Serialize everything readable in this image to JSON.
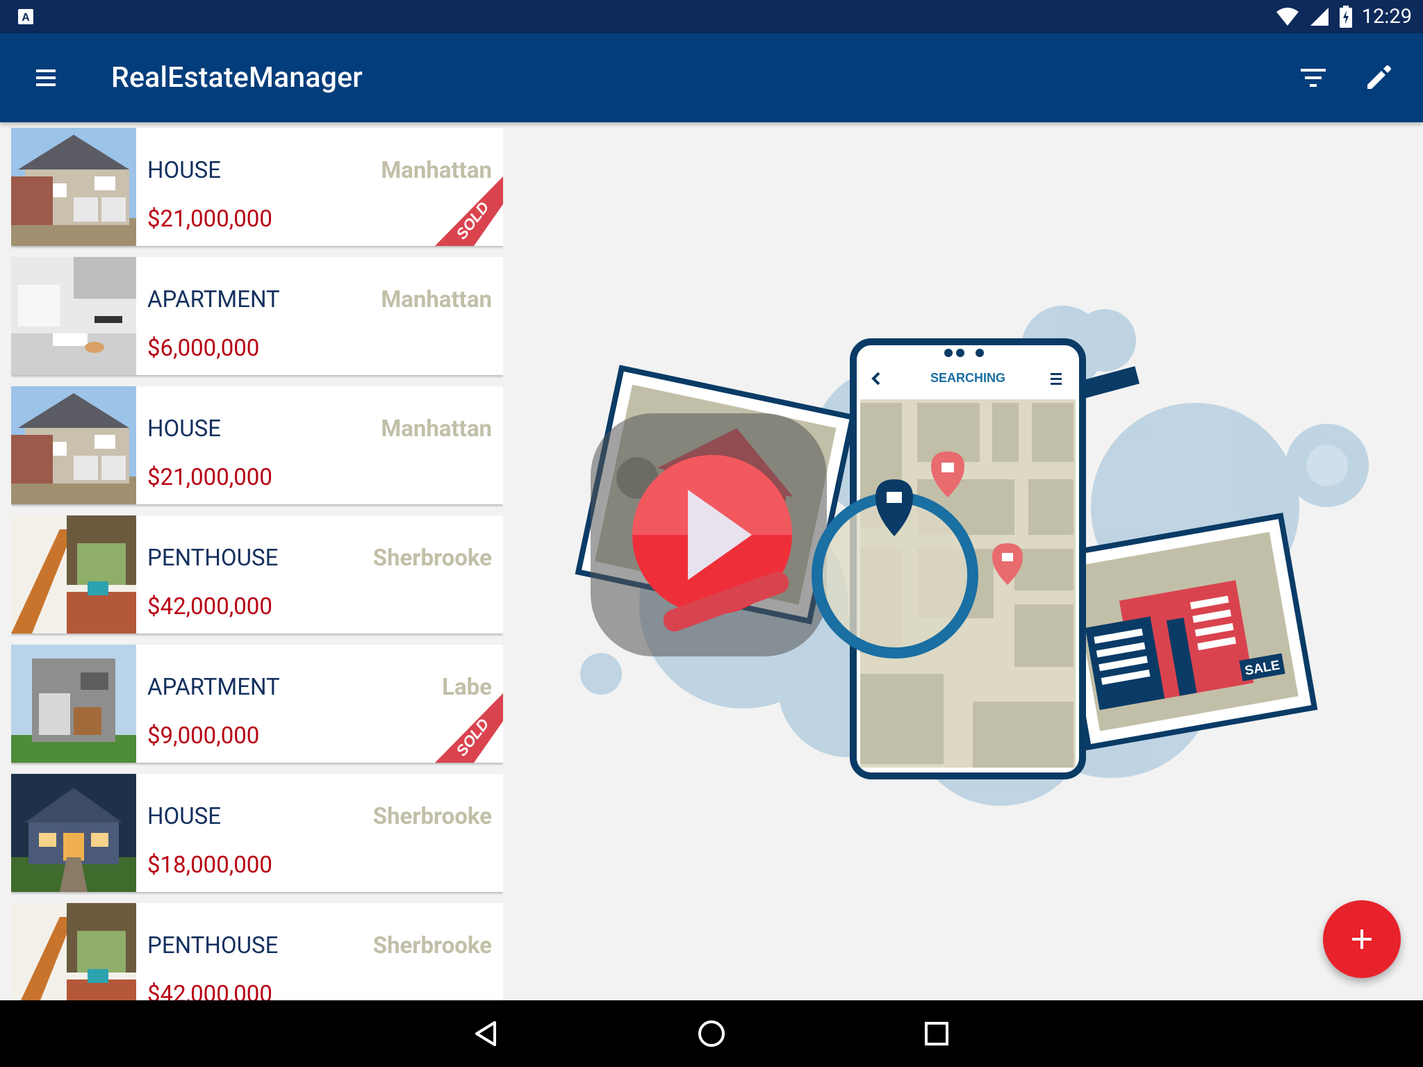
{
  "status_bar": {
    "left_icon": "accessibility-a-icon",
    "time": "12:29",
    "icons": [
      "wifi-icon",
      "signal-icon",
      "battery-charging-icon"
    ]
  },
  "app_bar": {
    "title": "RealEstateManager",
    "menu_icon": "hamburger-menu-icon",
    "filter_icon": "filter-icon",
    "edit_icon": "edit-pencil-icon"
  },
  "listings": [
    {
      "type": "HOUSE",
      "city": "Manhattan",
      "price": "$21,000,000",
      "sold": true,
      "sold_label": "SOLD",
      "photo": "house-brick"
    },
    {
      "type": "APARTMENT",
      "city": "Manhattan",
      "price": "$6,000,000",
      "sold": false,
      "photo": "interior-white"
    },
    {
      "type": "HOUSE",
      "city": "Manhattan",
      "price": "$21,000,000",
      "sold": false,
      "photo": "house-brick"
    },
    {
      "type": "PENTHOUSE",
      "city": "Sherbrooke",
      "price": "$42,000,000",
      "sold": false,
      "photo": "stairs-wood"
    },
    {
      "type": "APARTMENT",
      "city": "Labe",
      "price": "$9,000,000",
      "sold": true,
      "sold_label": "SOLD",
      "photo": "modern-gray"
    },
    {
      "type": "HOUSE",
      "city": "Sherbrooke",
      "price": "$18,000,000",
      "sold": false,
      "photo": "house-blue"
    },
    {
      "type": "PENTHOUSE",
      "city": "Sherbrooke",
      "price": "$42,000,000",
      "sold": false,
      "photo": "stairs-wood"
    }
  ],
  "illustration": {
    "phone_title": "SEARCHING",
    "sale_sign": "SALE",
    "play_icon": "video-play-icon"
  },
  "fab": {
    "icon": "plus-icon"
  },
  "nav_bar": {
    "icons": [
      "back-triangle-icon",
      "home-circle-icon",
      "recents-square-icon"
    ]
  },
  "colors": {
    "status_bar": "#0d2a5a",
    "app_bar": "#033d7b",
    "type_text": "#14305e",
    "price_text": "#b80012",
    "city_text": "#c2bfa8",
    "sold_ribbon": "#d9434e",
    "fab": "#e8222a"
  }
}
